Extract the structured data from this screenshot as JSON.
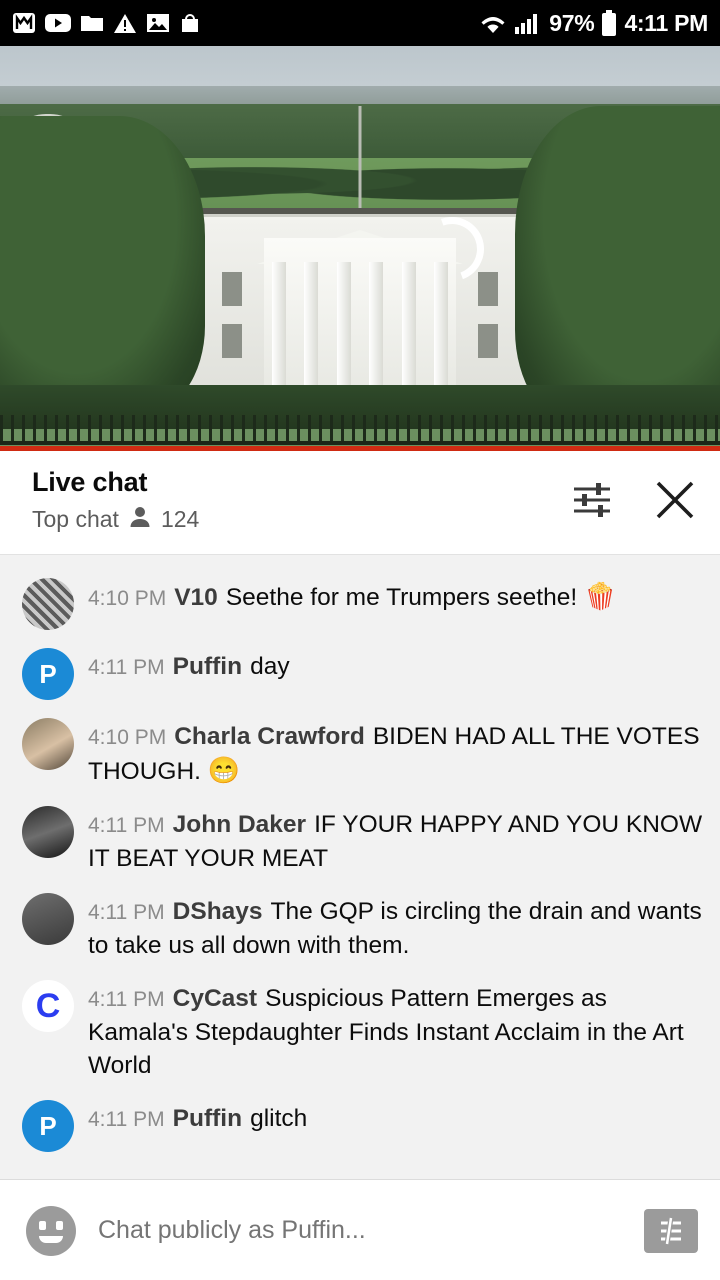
{
  "status_bar": {
    "icons": [
      "monzo-icon",
      "youtube-icon",
      "folder-icon",
      "warning-icon",
      "photo-icon",
      "bag-icon"
    ],
    "wifi_icon": "wifi-icon",
    "signal_icon": "cell-signal-icon",
    "battery_percent": "97%",
    "battery_icon": "battery-icon",
    "time": "4:11 PM"
  },
  "video": {
    "title": "white-house-live-stream",
    "spinner": "loading-spinner",
    "progress_color": "#cf2a12"
  },
  "chat_header": {
    "title": "Live chat",
    "mode_label": "Top chat",
    "viewer_icon": "person-icon",
    "viewer_count": "124",
    "settings_icon": "chat-settings-icon",
    "close_icon": "close-icon"
  },
  "messages": [
    {
      "avatar": "av-v10",
      "avatar_initial": "",
      "time": "4:10 PM",
      "author": "V10",
      "text": "Seethe for me Trumpers seethe!",
      "emoji": "🍿"
    },
    {
      "avatar": "av-puffin",
      "avatar_initial": "P",
      "time": "4:11 PM",
      "author": "Puffin",
      "text": "day",
      "emoji": ""
    },
    {
      "avatar": "av-charla",
      "avatar_initial": "",
      "time": "4:10 PM",
      "author": "Charla Crawford",
      "text": "BIDEN HAD ALL THE VOTES THOUGH.",
      "emoji": "😁"
    },
    {
      "avatar": "av-john",
      "avatar_initial": "",
      "time": "4:11 PM",
      "author": "John Daker",
      "text": "IF YOUR HAPPY AND YOU KNOW IT BEAT YOUR MEAT",
      "emoji": ""
    },
    {
      "avatar": "av-dshays",
      "avatar_initial": "",
      "time": "4:11 PM",
      "author": "DShays",
      "text": "The GQP is circling the drain and wants to take us all down with them.",
      "emoji": ""
    },
    {
      "avatar": "av-cycast",
      "avatar_initial": "C",
      "time": "4:11 PM",
      "author": "CyCast",
      "text": "Suspicious Pattern Emerges as Kamala's Stepdaughter Finds Instant Acclaim in the Art World",
      "emoji": ""
    },
    {
      "avatar": "av-puffin",
      "avatar_initial": "P",
      "time": "4:11 PM",
      "author": "Puffin",
      "text": "glitch",
      "emoji": ""
    }
  ],
  "composer": {
    "emoji_icon": "emoji-face-icon",
    "placeholder": "Chat publicly as Puffin...",
    "send_icon": "super-chat-icon"
  }
}
